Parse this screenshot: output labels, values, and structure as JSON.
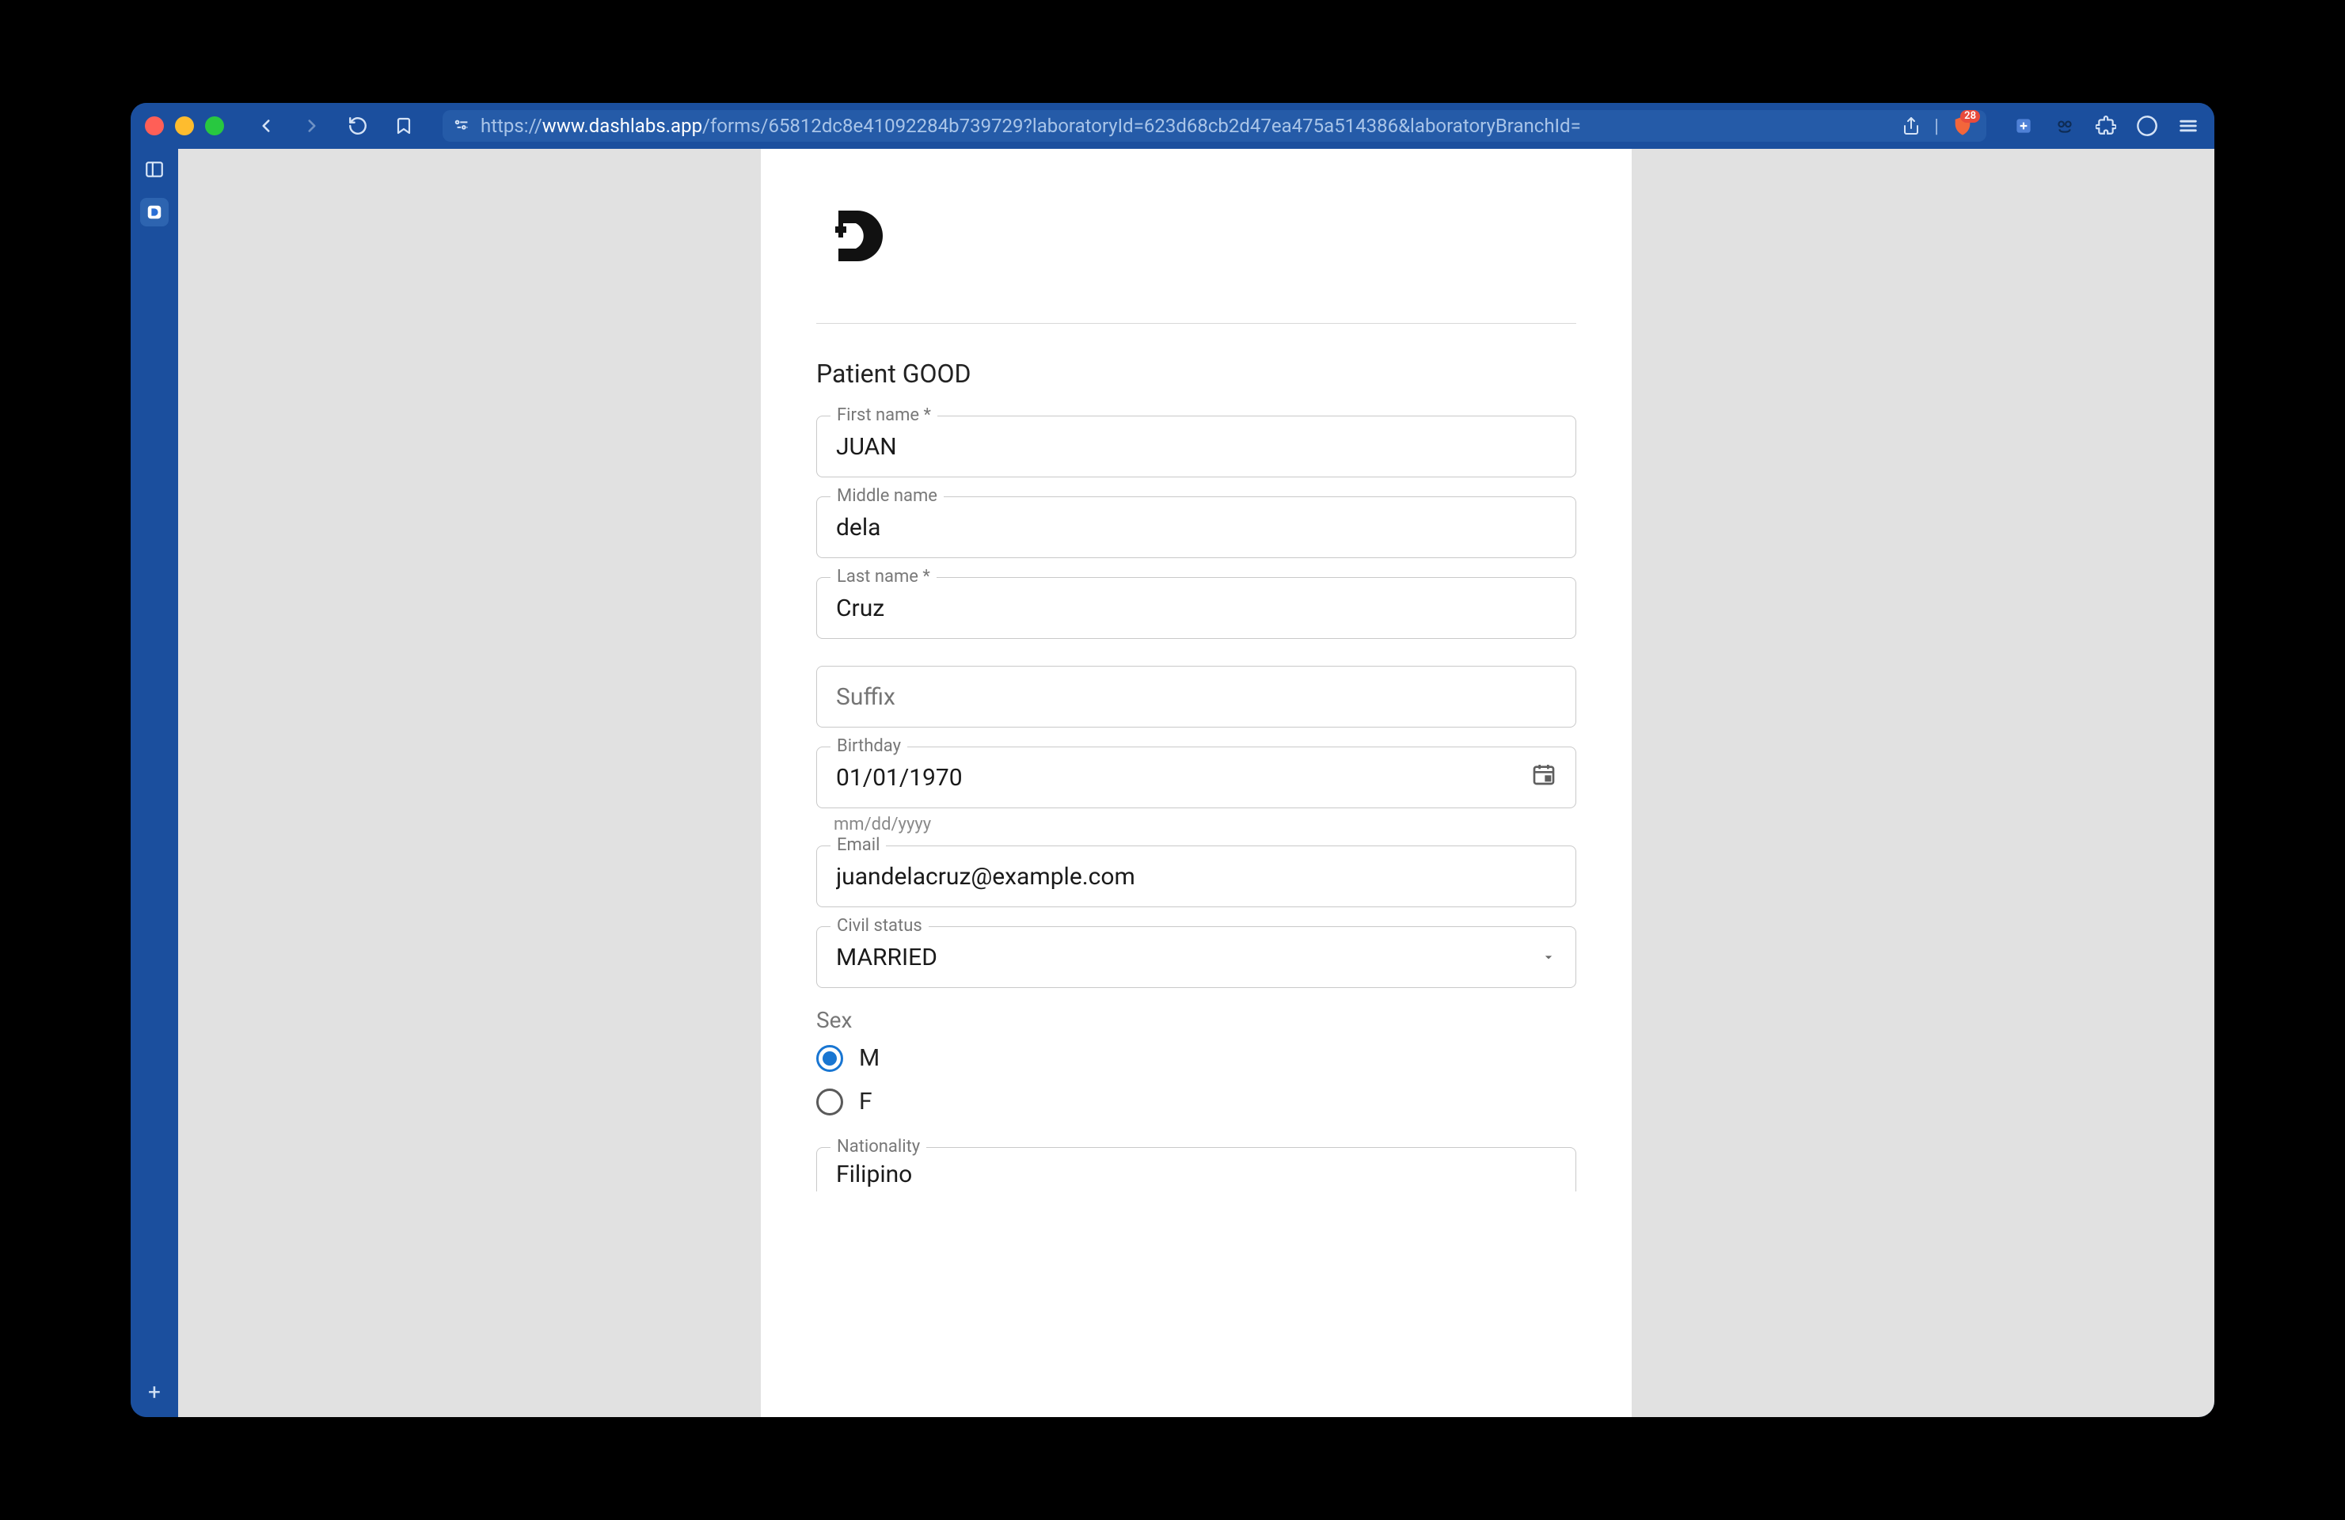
{
  "browser": {
    "url_scheme": "https://",
    "url_host": "www.dashlabs.app",
    "url_path": "/forms/65812dc8e41092284b739729?laboratoryId=623d68cb2d47ea475a514386&laboratoryBranchId=",
    "shield_count": "28"
  },
  "form": {
    "section_title": "Patient GOOD",
    "first_name": {
      "label": "First name *",
      "value": "JUAN"
    },
    "middle_name": {
      "label": "Middle name",
      "value": "dela"
    },
    "last_name": {
      "label": "Last name *",
      "value": "Cruz"
    },
    "suffix": {
      "placeholder": "Suffix",
      "value": ""
    },
    "birthday": {
      "label": "Birthday",
      "value": "01/01/1970",
      "helper": "mm/dd/yyyy"
    },
    "email": {
      "label": "Email",
      "value": "juandelacruz@example.com"
    },
    "civil_status": {
      "label": "Civil status",
      "value": "MARRIED"
    },
    "sex": {
      "label": "Sex",
      "options": {
        "m": "M",
        "f": "F"
      },
      "selected": "M"
    },
    "nationality": {
      "label": "Nationality",
      "value": "Filipino"
    }
  }
}
